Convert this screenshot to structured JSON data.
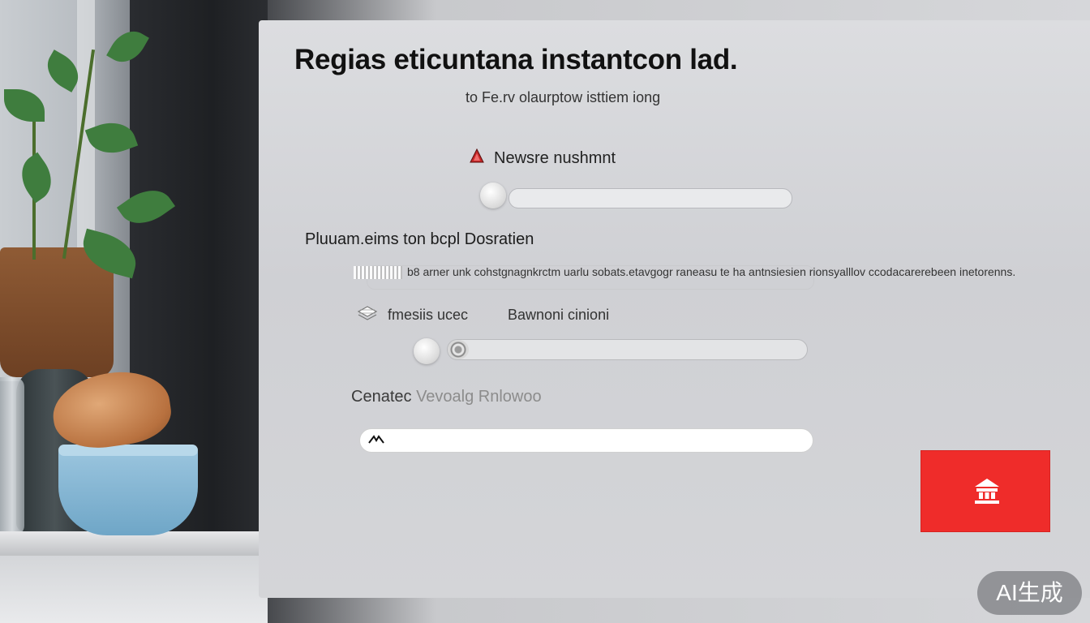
{
  "form": {
    "title": "Regias eticuntana instantcon lad.",
    "subtitle": "to Fe.rv olaurptow isttiem iong",
    "field1": {
      "label": "Newsre nushmnt",
      "icon": "warning-icon"
    },
    "section": {
      "label": "Pluuam.eims ton bcpl  Dosratien"
    },
    "helper": {
      "text": "b8 arner unk cohstgnagnkrctm uarlu sobats.etavgogr raneasu te ha antnsiesien rionsyalllov ccodacarerebeen inetorenns."
    },
    "row": {
      "label_left": "fmesiis ucec",
      "label_right": "Bawnoni cinioni",
      "icon": "layers-icon"
    },
    "slider": {
      "value": 0
    },
    "confirm": {
      "label_part1": "Cenatec",
      "label_part2": "Vevoalg Rnlowoo"
    },
    "text_input": {
      "value": ""
    },
    "submit_button": {
      "icon": "building-icon",
      "color": "#ef2c2a"
    }
  },
  "watermark": {
    "text": "AI生成"
  }
}
